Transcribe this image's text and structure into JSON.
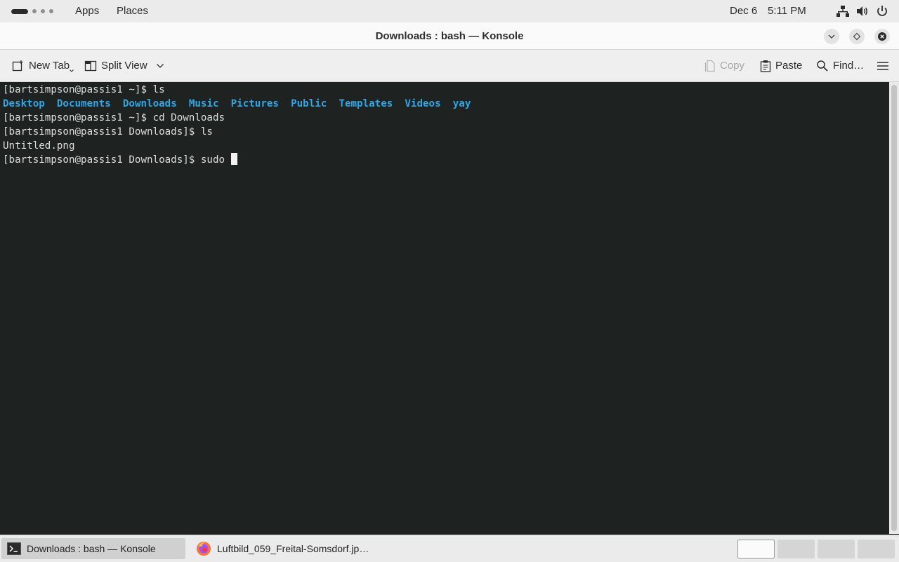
{
  "topbar": {
    "apps_label": "Apps",
    "places_label": "Places",
    "date": "Dec 6",
    "time": "5:11 PM",
    "tray_icons": [
      "network-icon",
      "volume-icon",
      "power-icon"
    ]
  },
  "window": {
    "title": "Downloads : bash — Konsole",
    "controls": [
      "minimize-icon",
      "maximize-icon",
      "close-icon"
    ]
  },
  "toolbar": {
    "new_tab_label": "New Tab",
    "split_view_label": "Split View",
    "copy_label": "Copy",
    "paste_label": "Paste",
    "find_label": "Find…"
  },
  "terminal": {
    "line1": "[bartsimpson@passis1 ~]$ ls",
    "dirs": [
      "Desktop",
      "Documents",
      "Downloads",
      "Music",
      "Pictures",
      "Public",
      "Templates",
      "Videos",
      "yay"
    ],
    "line3": "[bartsimpson@passis1 ~]$ cd Downloads",
    "line4": "[bartsimpson@passis1 Downloads]$ ls",
    "line5": "Untitled.png",
    "line6": "[bartsimpson@passis1 Downloads]$ sudo "
  },
  "taskbar": {
    "task1_label": "Downloads : bash — Konsole",
    "task2_label": "Luftbild_059_Freital-Somsdorf.jp…",
    "workspace_count": 4,
    "current_workspace": 1
  },
  "colors": {
    "terminal_bg": "#1e2221",
    "terminal_fg": "#dcdcdc",
    "directory_color": "#2fa6e6"
  }
}
